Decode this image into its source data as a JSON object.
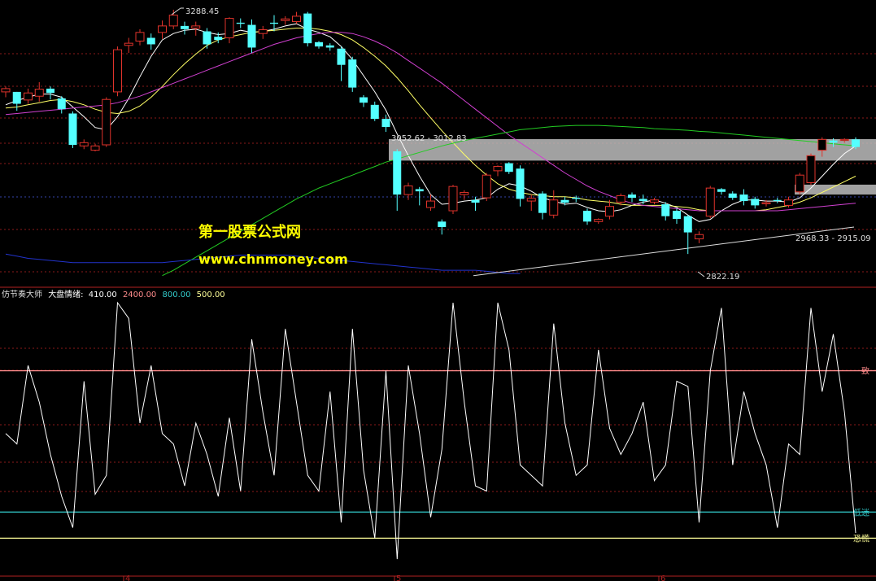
{
  "colors": {
    "background": "#000000",
    "up_candle": "#e0332b",
    "down_candle": "#54ffff",
    "ma_fast": "#ffffff",
    "ma_mid": "#ffff66",
    "ma_slow": "#d040d0",
    "ma_long": "#22cc22",
    "ma_longest": "#2233cc",
    "grid": "#8b1a1a",
    "zone": "#bdbdbd",
    "oscillator": "#ffffff",
    "ref_upper": "#ff8c8c",
    "ref_mid": "#33cccc",
    "ref_lower": "#ffff99",
    "watermark": "#ffff00"
  },
  "price_annotations": {
    "high": "3288.45",
    "low": "2822.19",
    "upper_zone": "3052.62 - 3012.83",
    "lower_zone": "2968.33 - 2915.09"
  },
  "watermark": {
    "line1": "第一股票公式网",
    "line2": "www.chnmoney.com"
  },
  "indicator": {
    "name": "仿节奏大师",
    "title": "大盘情绪:",
    "v1": "410.00",
    "v2": "2400.00",
    "v3": "800.00",
    "v4": "500.00",
    "ref_upper_label": "一致",
    "ref_mid_label": "低迷",
    "ref_lower_label": "恐慌"
  },
  "date_ticks": [
    "4",
    "5",
    "6"
  ],
  "chart_data": [
    {
      "type": "candlestick",
      "ylim": [
        2780,
        3310
      ],
      "series": [
        {
          "name": "K",
          "candles": [
            [
              3140,
              3146,
              3130,
              3150
            ],
            [
              3140,
              3118,
              3105,
              3140
            ],
            [
              3125,
              3138,
              3118,
              3146
            ],
            [
              3132,
              3145,
              3122,
              3158
            ],
            [
              3146,
              3138,
              3126,
              3150
            ],
            [
              3128,
              3108,
              3100,
              3132
            ],
            [
              3100,
              3042,
              3036,
              3104
            ],
            [
              3040,
              3046,
              3034,
              3052
            ],
            [
              3032,
              3040,
              3030,
              3044
            ],
            [
              3042,
              3126,
              3038,
              3130
            ],
            [
              3140,
              3218,
              3132,
              3224
            ],
            [
              3226,
              3230,
              3212,
              3240
            ],
            [
              3234,
              3250,
              3226,
              3256
            ],
            [
              3240,
              3228,
              3218,
              3248
            ],
            [
              3250,
              3262,
              3238,
              3272
            ],
            [
              3262,
              3282,
              3256,
              3292
            ],
            [
              3262,
              3256,
              3246,
              3270
            ],
            [
              3258,
              3262,
              3244,
              3270
            ],
            [
              3252,
              3228,
              3220,
              3258
            ],
            [
              3242,
              3236,
              3230,
              3250
            ],
            [
              3240,
              3276,
              3230,
              3278
            ],
            [
              3268,
              3266,
              3258,
              3276
            ],
            [
              3264,
              3222,
              3212,
              3274
            ],
            [
              3248,
              3255,
              3238,
              3262
            ],
            [
              3268,
              3266,
              3252,
              3282
            ],
            [
              3272,
              3275,
              3264,
              3280
            ],
            [
              3270,
              3280,
              3266,
              3288
            ],
            [
              3285,
              3230,
              3224,
              3288
            ],
            [
              3232,
              3224,
              3220,
              3234
            ],
            [
              3226,
              3222,
              3216,
              3230
            ],
            [
              3220,
              3190,
              3160,
              3224
            ],
            [
              3200,
              3148,
              3140,
              3205
            ],
            [
              3130,
              3120,
              3112,
              3134
            ],
            [
              3116,
              3090,
              3086,
              3122
            ],
            [
              3090,
              3075,
              3066,
              3098
            ],
            [
              3030,
              2950,
              2920,
              3034
            ],
            [
              2950,
              2966,
              2940,
              2972
            ],
            [
              2960,
              2956,
              2930,
              2964
            ],
            [
              2926,
              2938,
              2920,
              2950
            ],
            [
              2900,
              2890,
              2876,
              2904
            ],
            [
              2920,
              2965,
              2914,
              2968
            ],
            [
              2950,
              2954,
              2940,
              2958
            ],
            [
              2940,
              2935,
              2920,
              2946
            ],
            [
              2944,
              2986,
              2938,
              2990
            ],
            [
              2994,
              3002,
              2984,
              3004
            ],
            [
              3008,
              2992,
              2988,
              3010
            ],
            [
              2998,
              2942,
              2928,
              3004
            ],
            [
              2938,
              2943,
              2920,
              2950
            ],
            [
              2952,
              2916,
              2904,
              2956
            ],
            [
              2912,
              2940,
              2906,
              2958
            ],
            [
              2940,
              2935,
              2930,
              2946
            ],
            [
              2944,
              2942,
              2936,
              2948
            ],
            [
              2920,
              2900,
              2894,
              2924
            ],
            [
              2900,
              2904,
              2896,
              2906
            ],
            [
              2910,
              2928,
              2904,
              2940
            ],
            [
              2936,
              2948,
              2930,
              2952
            ],
            [
              2950,
              2944,
              2936,
              2954
            ],
            [
              2942,
              2938,
              2932,
              2950
            ],
            [
              2936,
              2940,
              2932,
              2944
            ],
            [
              2932,
              2910,
              2902,
              2936
            ],
            [
              2920,
              2905,
              2896,
              2924
            ],
            [
              2910,
              2880,
              2840,
              2912
            ],
            [
              2868,
              2876,
              2860,
              2882
            ],
            [
              2910,
              2962,
              2906,
              2966
            ],
            [
              2960,
              2955,
              2950,
              2962
            ],
            [
              2952,
              2944,
              2940,
              2956
            ],
            [
              2950,
              2938,
              2930,
              2960
            ],
            [
              2942,
              2930,
              2924,
              2946
            ],
            [
              2933,
              2935,
              2928,
              2940
            ],
            [
              2940,
              2938,
              2934,
              2944
            ],
            [
              2930,
              2940,
              2926,
              2946
            ],
            [
              2955,
              2986,
              2950,
              2990
            ],
            [
              2972,
              3022,
              2968,
              3026
            ],
            [
              3032,
              3052,
              3020,
              3056
            ],
            [
              3050,
              3046,
              3038,
              3054
            ],
            [
              3050,
              3052,
              3046,
              3054
            ],
            [
              3052,
              3038,
              3034,
              3056
            ]
          ]
        },
        {
          "name": "MA5",
          "values": [
            3116,
            3124,
            3130,
            3136,
            3136,
            3130,
            3112,
            3094,
            3074,
            3070,
            3094,
            3128,
            3168,
            3206,
            3236,
            3248,
            3254,
            3256,
            3250,
            3246,
            3248,
            3254,
            3250,
            3252,
            3256,
            3262,
            3266,
            3256,
            3250,
            3242,
            3224,
            3200,
            3170,
            3140,
            3106,
            3062,
            3022,
            2984,
            2950,
            2932,
            2934,
            2938,
            2940,
            2944,
            2960,
            2970,
            2966,
            2956,
            2944,
            2938,
            2932,
            2934,
            2926,
            2920,
            2918,
            2922,
            2930,
            2936,
            2940,
            2934,
            2926,
            2912,
            2900,
            2904,
            2920,
            2932,
            2940,
            2940,
            2938,
            2938,
            2936,
            2944,
            2962,
            2984,
            3006,
            3026,
            3040
          ]
        },
        {
          "name": "MA10",
          "values": [
            3110,
            3112,
            3116,
            3120,
            3124,
            3126,
            3122,
            3116,
            3108,
            3102,
            3100,
            3104,
            3114,
            3130,
            3150,
            3172,
            3192,
            3210,
            3226,
            3236,
            3242,
            3246,
            3250,
            3252,
            3254,
            3256,
            3258,
            3258,
            3256,
            3252,
            3246,
            3236,
            3222,
            3206,
            3188,
            3166,
            3142,
            3116,
            3092,
            3068,
            3046,
            3024,
            3004,
            2986,
            2970,
            2960,
            2954,
            2950,
            2948,
            2946,
            2946,
            2944,
            2940,
            2938,
            2936,
            2932,
            2930,
            2930,
            2930,
            2930,
            2928,
            2926,
            2922,
            2920,
            2920,
            2920,
            2920,
            2920,
            2922,
            2926,
            2930,
            2936,
            2944,
            2954,
            2964,
            2974,
            2984
          ]
        },
        {
          "name": "MA20",
          "values": [
            3098,
            3100,
            3102,
            3104,
            3106,
            3108,
            3110,
            3112,
            3114,
            3116,
            3120,
            3126,
            3132,
            3140,
            3148,
            3156,
            3164,
            3172,
            3180,
            3188,
            3196,
            3204,
            3212,
            3220,
            3228,
            3234,
            3240,
            3244,
            3248,
            3250,
            3250,
            3248,
            3242,
            3234,
            3224,
            3212,
            3198,
            3184,
            3170,
            3156,
            3140,
            3124,
            3108,
            3092,
            3076,
            3060,
            3046,
            3032,
            3018,
            3004,
            2990,
            2978,
            2966,
            2956,
            2948,
            2940,
            2934,
            2930,
            2928,
            2926,
            2924,
            2922,
            2920,
            2920,
            2920,
            2920,
            2920,
            2920,
            2920,
            2920,
            2922,
            2924,
            2926,
            2928,
            2930,
            2932,
            2934
          ]
        },
        {
          "name": "MA60",
          "values": [
            null,
            null,
            null,
            null,
            null,
            null,
            null,
            null,
            null,
            null,
            null,
            null,
            null,
            null,
            2800,
            2810,
            2822,
            2834,
            2846,
            2858,
            2870,
            2882,
            2894,
            2906,
            2918,
            2930,
            2942,
            2952,
            2962,
            2970,
            2978,
            2986,
            2994,
            3002,
            3010,
            3016,
            3022,
            3028,
            3034,
            3040,
            3045,
            3050,
            3054,
            3058,
            3062,
            3066,
            3070,
            3072,
            3074,
            3076,
            3077,
            3078,
            3078,
            3078,
            3077,
            3076,
            3075,
            3074,
            3072,
            3071,
            3070,
            3069,
            3067,
            3066,
            3064,
            3062,
            3060,
            3058,
            3056,
            3054,
            3052,
            3050,
            3048,
            3046,
            3044,
            3042,
            3040
          ]
        },
        {
          "name": "MA120",
          "values": [
            2840,
            2836,
            2832,
            2830,
            2828,
            2826,
            2824,
            2824,
            2824,
            2824,
            2824,
            2824,
            2824,
            2824,
            2824,
            2826,
            2828,
            2830,
            2832,
            2834,
            2836,
            2838,
            2838,
            2838,
            2838,
            2838,
            2836,
            2834,
            2832,
            2830,
            2828,
            2826,
            2824,
            2822,
            2820,
            2818,
            2816,
            2814,
            2812,
            2810,
            2810,
            2810,
            2810,
            2808,
            2806,
            2804,
            2804,
            null,
            null,
            null,
            null,
            null,
            null,
            null,
            null,
            null,
            null,
            null,
            null,
            null,
            null,
            null,
            null,
            null,
            null,
            null,
            null,
            null,
            null,
            null,
            null,
            null,
            null,
            null,
            null,
            null,
            null
          ]
        }
      ]
    },
    {
      "type": "line",
      "ylim": [
        0,
        2550
      ],
      "series": [
        {
          "name": "大盘情绪",
          "values": [
            1300,
            1200,
            1950,
            1600,
            1100,
            700,
            400,
            1800,
            720,
            900,
            2550,
            2400,
            1400,
            1950,
            1300,
            1200,
            800,
            1400,
            1100,
            700,
            1450,
            750,
            2200,
            1500,
            900,
            2300,
            1600,
            900,
            750,
            1700,
            450,
            2300,
            950,
            300,
            1900,
            100,
            1950,
            1300,
            500,
            1150,
            2550,
            1600,
            800,
            750,
            2550,
            2100,
            1000,
            900,
            800,
            2350,
            1400,
            900,
            1000,
            2100,
            1350,
            1100,
            1300,
            1600,
            850,
            1000,
            1800,
            1750,
            450,
            1900,
            2500,
            1000,
            1700,
            1300,
            1000,
            400,
            1200,
            1100,
            2500,
            1700,
            2250,
            1500,
            350
          ]
        }
      ],
      "reference_lines": [
        {
          "label": "一致",
          "value": 1900
        },
        {
          "label": "低迷",
          "value": 550
        },
        {
          "label": "恐慌",
          "value": 300
        }
      ]
    }
  ]
}
